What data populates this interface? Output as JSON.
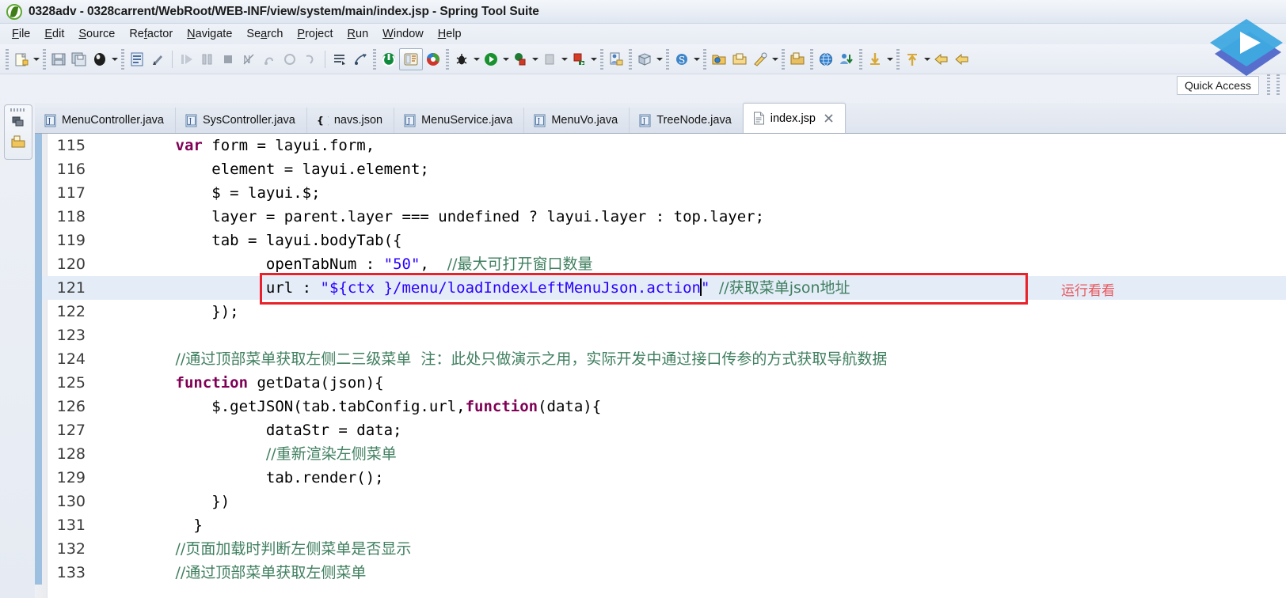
{
  "window": {
    "title": "0328adv - 0328carrent/WebRoot/WEB-INF/view/system/main/index.jsp - Spring Tool Suite",
    "app_logo_icon": "spring-tool-suite-logo-icon"
  },
  "menubar": {
    "items": [
      {
        "mnemonic": "F",
        "rest": "ile"
      },
      {
        "mnemonic": "E",
        "rest": "dit"
      },
      {
        "mnemonic": "S",
        "rest": "ource"
      },
      {
        "mnemonic": "R",
        "rest": "efactor",
        "pre": ""
      },
      {
        "mnemonic": "N",
        "rest": "avigate"
      },
      {
        "mnemonic": "S",
        "rest": "earch",
        "pre": ""
      },
      {
        "mnemonic": "P",
        "rest": "roject"
      },
      {
        "mnemonic": "R",
        "rest": "un"
      },
      {
        "mnemonic": "W",
        "rest": "indow"
      },
      {
        "mnemonic": "H",
        "rest": "elp"
      }
    ],
    "labels": [
      "File",
      "Edit",
      "Source",
      "Refactor",
      "Navigate",
      "Search",
      "Project",
      "Run",
      "Window",
      "Help"
    ]
  },
  "toolbar": {
    "buttons": [
      "new-wizard-button",
      "new-wizard-dropdown",
      "save-button",
      "save-all-button",
      "print-button",
      "print-dropdown",
      "open-type-button",
      "quick-outline-button",
      "step-into-button",
      "step-over-button",
      "terminate-button",
      "skip-breakpoints-button",
      "step-return-button",
      "resume-button",
      "drop-to-frame-button",
      "open-task-button",
      "link-task-button",
      "run-last-tool-button",
      "debug-perspective-button",
      "web-browser-button",
      "debug-button",
      "debug-dropdown",
      "run-button",
      "run-dropdown",
      "external-tools-button",
      "external-tools-dropdown",
      "coverage-button",
      "coverage-dropdown",
      "run-as-server-button",
      "run-as-server-dropdown",
      "new-java-class-button",
      "new-java-package-button",
      "new-java-package-dropdown",
      "spring-bean-button",
      "spring-bean-dropdown",
      "open-resource-button",
      "open-folder-button",
      "search-button",
      "search-dropdown",
      "new-file-button",
      "globe-button",
      "validate-button",
      "download-button",
      "download-dropdown",
      "upload-button",
      "upload-dropdown",
      "back-button",
      "forward-button"
    ]
  },
  "quick_access": {
    "label": "Quick Access",
    "search_icon": "quick-access-search-icon"
  },
  "left_stack": {
    "icons": [
      "package-explorer-icon",
      "project-explorer-icon"
    ]
  },
  "tabs": [
    {
      "label": "MenuController.java",
      "icon": "java-file-icon",
      "active": false,
      "closable": false
    },
    {
      "label": "SysController.java",
      "icon": "java-file-icon",
      "active": false,
      "closable": false
    },
    {
      "label": "navs.json",
      "icon": "json-file-icon",
      "active": false,
      "closable": false
    },
    {
      "label": "MenuService.java",
      "icon": "java-file-icon",
      "active": false,
      "closable": false
    },
    {
      "label": "MenuVo.java",
      "icon": "java-file-icon",
      "active": false,
      "closable": false
    },
    {
      "label": "TreeNode.java",
      "icon": "java-file-icon",
      "active": false,
      "closable": false
    },
    {
      "label": "index.jsp",
      "icon": "jsp-file-icon",
      "active": true,
      "closable": true
    }
  ],
  "editor": {
    "language": "jsp",
    "current_line": 121,
    "first_visible_line": 115,
    "last_visible_line": 133,
    "lines": [
      {
        "n": "115",
        "indent": 4,
        "tokens": [
          {
            "t": "var",
            "c": "kw"
          },
          {
            "t": " form = layui.form,",
            "c": "plain"
          }
        ]
      },
      {
        "n": "116",
        "indent": 6,
        "tokens": [
          {
            "t": "element = layui.element;",
            "c": "plain"
          }
        ]
      },
      {
        "n": "117",
        "indent": 6,
        "tokens": [
          {
            "t": "$ = layui.$;",
            "c": "plain"
          }
        ]
      },
      {
        "n": "118",
        "indent": 6,
        "tokens": [
          {
            "t": "layer = parent.layer === undefined ? layui.layer : top.layer;",
            "c": "plain"
          }
        ]
      },
      {
        "n": "119",
        "indent": 6,
        "tokens": [
          {
            "t": "tab = layui.bodyTab({",
            "c": "plain"
          }
        ]
      },
      {
        "n": "120",
        "indent": 9,
        "tokens": [
          {
            "t": "openTabNum : ",
            "c": "plain"
          },
          {
            "t": "\"50\"",
            "c": "str"
          },
          {
            "t": ",  ",
            "c": "plain"
          },
          {
            "t": "//最大可打开窗口数量",
            "c": "cmt cn"
          }
        ]
      },
      {
        "n": "121",
        "indent": 9,
        "current": true,
        "tokens": [
          {
            "t": "url : ",
            "c": "plain"
          },
          {
            "t": "\"${ctx }/menu/loadIndexLeftMenuJson.action",
            "c": "str"
          },
          {
            "t": "CARET",
            "c": "caret"
          },
          {
            "t": "\"",
            "c": "str"
          },
          {
            "t": " ",
            "c": "plain"
          },
          {
            "t": "//获取菜单json地址",
            "c": "cmt cn"
          }
        ]
      },
      {
        "n": "122",
        "indent": 6,
        "tokens": [
          {
            "t": "});",
            "c": "plain"
          }
        ]
      },
      {
        "n": "123",
        "indent": 0,
        "tokens": []
      },
      {
        "n": "124",
        "indent": 4,
        "tokens": [
          {
            "t": "//通过顶部菜单获取左侧二三级菜单  注：此处只做演示之用，实际开发中通过接口传参的方式获取导航数据",
            "c": "cmt cn"
          }
        ]
      },
      {
        "n": "125",
        "indent": 4,
        "tokens": [
          {
            "t": "function",
            "c": "kw"
          },
          {
            "t": " getData(json){",
            "c": "plain"
          }
        ]
      },
      {
        "n": "126",
        "indent": 6,
        "tokens": [
          {
            "t": "$.getJSON(tab.tabConfig.url,",
            "c": "plain"
          },
          {
            "t": "function",
            "c": "kw"
          },
          {
            "t": "(data){",
            "c": "plain"
          }
        ]
      },
      {
        "n": "127",
        "indent": 9,
        "tokens": [
          {
            "t": "dataStr = data;",
            "c": "plain"
          }
        ]
      },
      {
        "n": "128",
        "indent": 9,
        "tokens": [
          {
            "t": "//重新渲染左侧菜单",
            "c": "cmt cn"
          }
        ]
      },
      {
        "n": "129",
        "indent": 9,
        "tokens": [
          {
            "t": "tab.render();",
            "c": "plain"
          }
        ]
      },
      {
        "n": "130",
        "indent": 6,
        "tokens": [
          {
            "t": "})",
            "c": "plain"
          }
        ]
      },
      {
        "n": "131",
        "indent": 5,
        "tokens": [
          {
            "t": "}",
            "c": "plain"
          }
        ]
      },
      {
        "n": "132",
        "indent": 4,
        "tokens": [
          {
            "t": "//页面加载时判断左侧菜单是否显示",
            "c": "cmt cn"
          }
        ]
      },
      {
        "n": "133",
        "indent": 4,
        "tokens": [
          {
            "t": "//通过顶部菜单获取左侧菜单",
            "c": "cmt cn"
          }
        ]
      }
    ]
  },
  "annotation": {
    "note_text": "运行看看",
    "note_color": "#e8575d",
    "box_color": "#e8212a"
  },
  "colors": {
    "keyword": "#7f0055",
    "string": "#2a00ff",
    "comment": "#3f7f5f",
    "current_line_highlight": "#e4ecf7",
    "gutter_changebar": "#9ec0e0",
    "editor_background": "#ffffff"
  }
}
